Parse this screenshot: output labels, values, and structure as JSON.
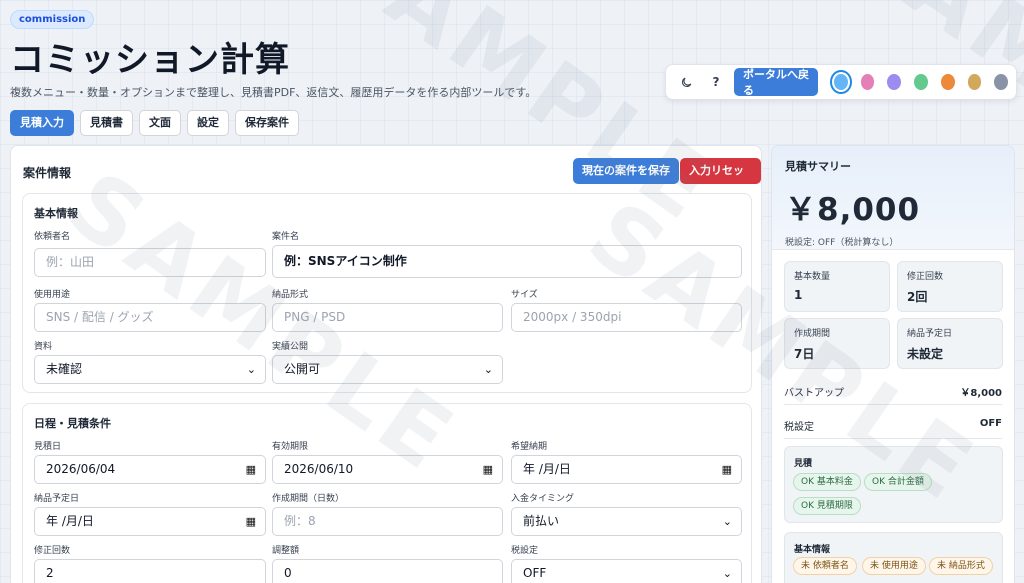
{
  "header": {
    "badge": "commission",
    "title": "コミッション計算",
    "subtitle": "複数メニュー・数量・オプションまで整理し、見積書PDF、返信文、履歴用データを作る内部ツールです。"
  },
  "toolbar": {
    "dark_mode_icon": "moon-icon",
    "help_label": "?",
    "portal_label": "ポータルへ戻る",
    "theme_colors": [
      "#64b5f6",
      "#e57fb8",
      "#9b8cf0",
      "#63c98c",
      "#ec8a3a",
      "#d1a85c",
      "#8a93a6"
    ]
  },
  "tabs": [
    "見積入力",
    "見積書",
    "文面",
    "設定",
    "保存案件"
  ],
  "panel": {
    "title": "案件情報",
    "save_label": "現在の案件を保存",
    "reset_label": "入力リセット",
    "basic": {
      "title": "基本情報",
      "client_label": "依頼者名",
      "client_placeholder": "例：山田",
      "case_label": "案件名",
      "case_value": "例：SNSアイコン制作",
      "usage_label": "使用用途",
      "usage_placeholder": "SNS / 配信 / グッズ",
      "format_label": "納品形式",
      "format_placeholder": "PNG / PSD",
      "size_label": "サイズ",
      "size_placeholder": "2000px / 350dpi",
      "material_label": "資料",
      "material_value": "未確認",
      "publish_label": "実績公開",
      "publish_value": "公開可"
    },
    "schedule": {
      "title": "日程・見積条件",
      "quote_date_label": "見積日",
      "quote_date_value": "2026/06/04",
      "valid_label": "有効期限",
      "valid_value": "2026/06/10",
      "desired_label": "希望納期",
      "desired_value": "年 /月/日",
      "delivery_label": "納品予定日",
      "delivery_value": "年 /月/日",
      "period_label": "作成期間（日数）",
      "period_placeholder": "例：8",
      "payment_label": "入金タイミング",
      "payment_value": "前払い",
      "revisions_label": "修正回数",
      "revisions_value": "2",
      "adjust_label": "調整額",
      "adjust_value": "0",
      "tax_label": "税設定",
      "tax_value": "OFF"
    }
  },
  "summary": {
    "title": "見積サマリー",
    "price": "￥8,000",
    "tax_note": "税設定: OFF（税計算なし）",
    "stats": [
      {
        "label": "基本数量",
        "value": "1"
      },
      {
        "label": "修正回数",
        "value": "2回"
      },
      {
        "label": "作成期間",
        "value": "7日"
      },
      {
        "label": "納品予定日",
        "value": "未設定"
      }
    ],
    "lines": [
      {
        "label": "バストアップ",
        "value": "￥8,000"
      },
      {
        "label": "税設定",
        "value": "OFF"
      }
    ],
    "check_quote": {
      "title": "見積",
      "chips": [
        "OK 基本料金",
        "OK 合計金額",
        "OK 見積期限"
      ]
    },
    "check_basic": {
      "title": "基本情報",
      "chips": [
        "未 依頼者名",
        "未 使用用途",
        "未 納品形式"
      ]
    }
  }
}
